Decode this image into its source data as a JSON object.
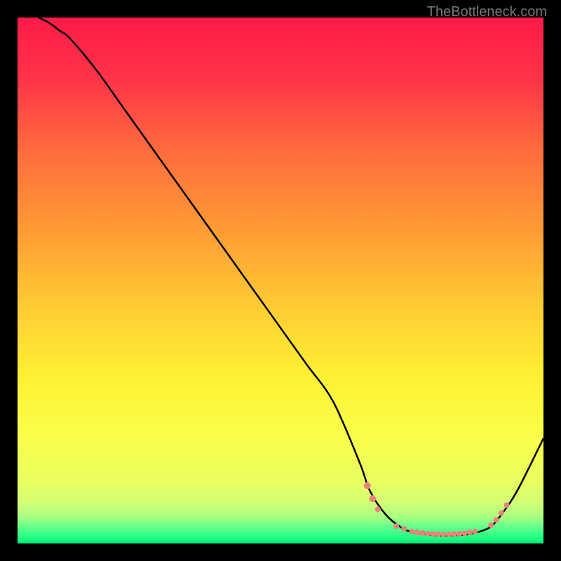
{
  "watermark": "TheBottleneck.com",
  "chart_data": {
    "type": "line",
    "title": "",
    "xlabel": "",
    "ylabel": "",
    "xlim": [
      0,
      100
    ],
    "ylim": [
      0,
      100
    ],
    "grid": false,
    "series": [
      {
        "name": "curve",
        "color": "#000000",
        "x": [
          4,
          6,
          8,
          10,
          15,
          20,
          25,
          30,
          35,
          40,
          45,
          50,
          55,
          60,
          65,
          67,
          70,
          73,
          75,
          78,
          80,
          82,
          84,
          86,
          88,
          90,
          92,
          95,
          100
        ],
        "values": [
          100,
          99,
          97.5,
          96,
          90,
          83,
          76,
          69,
          62,
          55,
          48,
          41,
          34,
          27,
          15.5,
          10,
          5.5,
          3,
          2.2,
          1.7,
          1.5,
          1.5,
          1.6,
          1.8,
          2.3,
          3.2,
          5.5,
          10,
          20
        ]
      }
    ],
    "markers": [
      {
        "x": 66.5,
        "y": 11,
        "r": 5,
        "color": "#e8847c"
      },
      {
        "x": 67.5,
        "y": 8.5,
        "r": 5,
        "color": "#e8847c"
      },
      {
        "x": 68.5,
        "y": 6.5,
        "r": 4,
        "color": "#e8847c"
      },
      {
        "x": 72,
        "y": 3.3,
        "r": 4,
        "color": "#e8847c"
      },
      {
        "x": 73.5,
        "y": 2.8,
        "r": 4,
        "color": "#e8847c"
      },
      {
        "x": 75,
        "y": 2.3,
        "r": 4,
        "color": "#e8847c"
      },
      {
        "x": 76,
        "y": 2.1,
        "r": 4,
        "color": "#e8847c"
      },
      {
        "x": 77,
        "y": 2.0,
        "r": 4,
        "color": "#e8847c"
      },
      {
        "x": 78,
        "y": 1.9,
        "r": 4,
        "color": "#e8847c"
      },
      {
        "x": 79,
        "y": 1.8,
        "r": 4,
        "color": "#e8847c"
      },
      {
        "x": 80,
        "y": 1.75,
        "r": 4,
        "color": "#e8847c"
      },
      {
        "x": 81,
        "y": 1.72,
        "r": 4,
        "color": "#e8847c"
      },
      {
        "x": 82,
        "y": 1.75,
        "r": 4,
        "color": "#e8847c"
      },
      {
        "x": 83,
        "y": 1.8,
        "r": 4,
        "color": "#e8847c"
      },
      {
        "x": 84,
        "y": 1.85,
        "r": 4,
        "color": "#e8847c"
      },
      {
        "x": 85,
        "y": 1.95,
        "r": 4,
        "color": "#e8847c"
      },
      {
        "x": 86,
        "y": 2.1,
        "r": 4,
        "color": "#e8847c"
      },
      {
        "x": 87,
        "y": 2.3,
        "r": 4,
        "color": "#e8847c"
      },
      {
        "x": 90,
        "y": 3.5,
        "r": 4,
        "color": "#e8847c"
      },
      {
        "x": 91,
        "y": 4.5,
        "r": 4,
        "color": "#e8847c"
      },
      {
        "x": 92,
        "y": 5.8,
        "r": 4,
        "color": "#e8847c"
      },
      {
        "x": 93,
        "y": 7.3,
        "r": 4,
        "color": "#e8847c"
      }
    ],
    "gradient_stops": [
      {
        "offset": 0,
        "color": "#ff1a48"
      },
      {
        "offset": 12,
        "color": "#ff3548"
      },
      {
        "offset": 25,
        "color": "#ff6a3d"
      },
      {
        "offset": 40,
        "color": "#ff9a35"
      },
      {
        "offset": 55,
        "color": "#ffcc33"
      },
      {
        "offset": 68,
        "color": "#fff033"
      },
      {
        "offset": 80,
        "color": "#f9ff4a"
      },
      {
        "offset": 88,
        "color": "#eaff60"
      },
      {
        "offset": 92,
        "color": "#d5ff75"
      },
      {
        "offset": 95,
        "color": "#a8ff82"
      },
      {
        "offset": 97,
        "color": "#5eff8c"
      },
      {
        "offset": 99,
        "color": "#1fff80"
      },
      {
        "offset": 100,
        "color": "#00e878"
      }
    ]
  }
}
